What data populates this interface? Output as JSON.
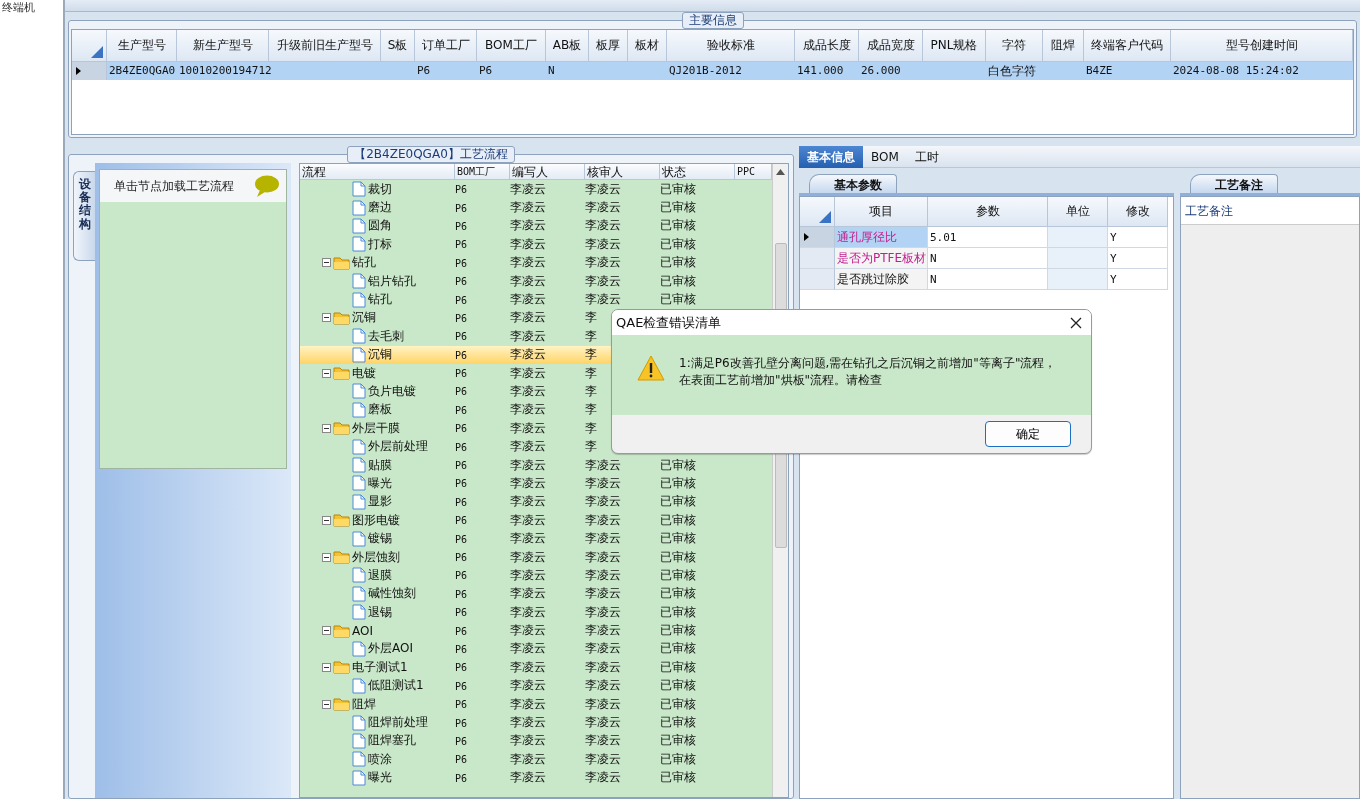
{
  "side_strip": {
    "text": "终端机"
  },
  "main_info": {
    "title": "主要信息",
    "columns": [
      "生产型号",
      "新生产型号",
      "升级前旧生产型号",
      "S板",
      "订单工厂",
      "BOM工厂",
      "AB板",
      "板厚",
      "板材",
      "验收标准",
      "成品长度",
      "成品宽度",
      "PNL规格",
      "字符",
      "阻焊",
      "终端客户代码",
      "型号创建时间"
    ],
    "rows": [
      {
        "selected": true,
        "cells": [
          "2B4ZE0QGA0",
          "10010200194712",
          "",
          "",
          "P6",
          "P6",
          "N",
          "",
          "",
          "QJ201B-2012",
          "141.000",
          "26.000",
          "",
          "白色字符",
          "",
          "B4ZE",
          "2024-08-08 15:24:02"
        ]
      }
    ]
  },
  "process": {
    "title": "【2B4ZE0QGA0】工艺流程",
    "side_tab": "设备结构",
    "hint": "单击节点加载工艺流程",
    "columns": [
      "流程",
      "BOM工厂",
      "编写人",
      "核审人",
      "状态",
      "PPC"
    ],
    "nodes": [
      {
        "children": [
          {
            "label": "裁切",
            "bom": "P6",
            "author": "李凌云",
            "reviewer": "李凌云",
            "status": "已审核",
            "selected": false
          },
          {
            "label": "磨边",
            "bom": "P6",
            "author": "李凌云",
            "reviewer": "李凌云",
            "status": "已审核",
            "selected": false
          },
          {
            "label": "圆角",
            "bom": "P6",
            "author": "李凌云",
            "reviewer": "李凌云",
            "status": "已审核",
            "selected": false
          },
          {
            "label": "打标",
            "bom": "P6",
            "author": "李凌云",
            "reviewer": "李凌云",
            "status": "已审核",
            "selected": false
          }
        ]
      },
      {
        "label": "钻孔",
        "bom": "P6",
        "author": "李凌云",
        "reviewer": "李凌云",
        "status": "已审核",
        "selected": false,
        "expanded": true,
        "children": [
          {
            "label": "铝片钻孔",
            "bom": "P6",
            "author": "李凌云",
            "reviewer": "李凌云",
            "status": "已审核",
            "selected": false
          },
          {
            "label": "钻孔",
            "bom": "P6",
            "author": "李凌云",
            "reviewer": "李凌云",
            "status": "已审核",
            "selected": false
          }
        ]
      },
      {
        "label": "沉铜",
        "bom": "P6",
        "author": "李凌云",
        "reviewer": "李",
        "selected": false,
        "expanded": true,
        "children": [
          {
            "label": "去毛刺",
            "bom": "P6",
            "author": "李凌云",
            "reviewer": "李",
            "selected": false
          },
          {
            "label": "沉铜",
            "bom": "P6",
            "author": "李凌云",
            "reviewer": "李",
            "selected": true
          }
        ]
      },
      {
        "label": "电镀",
        "bom": "P6",
        "author": "李凌云",
        "reviewer": "李",
        "selected": false,
        "expanded": true,
        "children": [
          {
            "label": "负片电镀",
            "bom": "P6",
            "author": "李凌云",
            "reviewer": "李",
            "selected": false
          },
          {
            "label": "磨板",
            "bom": "P6",
            "author": "李凌云",
            "reviewer": "李",
            "selected": false
          }
        ]
      },
      {
        "label": "外层干膜",
        "bom": "P6",
        "author": "李凌云",
        "reviewer": "李",
        "selected": false,
        "expanded": true,
        "children": [
          {
            "label": "外层前处理",
            "bom": "P6",
            "author": "李凌云",
            "reviewer": "李",
            "selected": false
          },
          {
            "label": "贴膜",
            "bom": "P6",
            "author": "李凌云",
            "reviewer": "李凌云",
            "status": "已审核",
            "selected": false
          },
          {
            "label": "曝光",
            "bom": "P6",
            "author": "李凌云",
            "reviewer": "李凌云",
            "status": "已审核",
            "selected": false
          },
          {
            "label": "显影",
            "bom": "P6",
            "author": "李凌云",
            "reviewer": "李凌云",
            "status": "已审核",
            "selected": false
          }
        ]
      },
      {
        "label": "图形电镀",
        "bom": "P6",
        "author": "李凌云",
        "reviewer": "李凌云",
        "status": "已审核",
        "selected": false,
        "expanded": true,
        "children": [
          {
            "label": "镀锡",
            "bom": "P6",
            "author": "李凌云",
            "reviewer": "李凌云",
            "status": "已审核",
            "selected": false
          }
        ]
      },
      {
        "label": "外层蚀刻",
        "bom": "P6",
        "author": "李凌云",
        "reviewer": "李凌云",
        "status": "已审核",
        "selected": false,
        "expanded": true,
        "children": [
          {
            "label": "退膜",
            "bom": "P6",
            "author": "李凌云",
            "reviewer": "李凌云",
            "status": "已审核",
            "selected": false
          },
          {
            "label": "碱性蚀刻",
            "bom": "P6",
            "author": "李凌云",
            "reviewer": "李凌云",
            "status": "已审核",
            "selected": false
          },
          {
            "label": "退锡",
            "bom": "P6",
            "author": "李凌云",
            "reviewer": "李凌云",
            "status": "已审核",
            "selected": false
          }
        ]
      },
      {
        "label": "AOI",
        "bom": "P6",
        "author": "李凌云",
        "reviewer": "李凌云",
        "status": "已审核",
        "selected": false,
        "expanded": true,
        "children": [
          {
            "label": "外层AOI",
            "bom": "P6",
            "author": "李凌云",
            "reviewer": "李凌云",
            "status": "已审核",
            "selected": false
          }
        ]
      },
      {
        "label": "电子测试1",
        "bom": "P6",
        "author": "李凌云",
        "reviewer": "李凌云",
        "status": "已审核",
        "selected": false,
        "expanded": true,
        "children": [
          {
            "label": "低阻测试1",
            "bom": "P6",
            "author": "李凌云",
            "reviewer": "李凌云",
            "status": "已审核",
            "selected": false
          }
        ]
      },
      {
        "label": "阻焊",
        "bom": "P6",
        "author": "李凌云",
        "reviewer": "李凌云",
        "status": "已审核",
        "selected": false,
        "expanded": true,
        "children": [
          {
            "label": "阻焊前处理",
            "bom": "P6",
            "author": "李凌云",
            "reviewer": "李凌云",
            "status": "已审核",
            "selected": false
          },
          {
            "label": "阻焊塞孔",
            "bom": "P6",
            "author": "李凌云",
            "reviewer": "李凌云",
            "status": "已审核",
            "selected": false
          },
          {
            "label": "喷涂",
            "bom": "P6",
            "author": "李凌云",
            "reviewer": "李凌云",
            "status": "已审核",
            "selected": false
          },
          {
            "label": "曝光",
            "bom": "P6",
            "author": "李凌云",
            "reviewer": "李凌云",
            "status": "已审核",
            "selected": false
          }
        ]
      }
    ]
  },
  "detail_tabs": [
    {
      "label": "基本信息",
      "selected": true
    },
    {
      "label": "BOM",
      "selected": false
    },
    {
      "label": "工时",
      "selected": false
    }
  ],
  "params": {
    "tab": "基本参数",
    "columns": [
      "项目",
      "参数",
      "单位",
      "修改"
    ],
    "rows": [
      {
        "item": "通孔厚径比",
        "value": "5.01",
        "unit": "",
        "modified": "Y",
        "highlighted": true,
        "selected": true
      },
      {
        "item": "是否为PTFE板材",
        "value": "N",
        "unit": "",
        "modified": "Y",
        "highlighted": true,
        "selected": false
      },
      {
        "item": "是否跳过除胶",
        "value": "N",
        "unit": "",
        "modified": "Y",
        "highlighted": false,
        "selected": false
      }
    ]
  },
  "remarks": {
    "tab": "工艺备注",
    "label": "工艺备注"
  },
  "dialog": {
    "title": "QAE检查错误清单",
    "message": "1:满足P6改善孔壁分离问题,需在钻孔之后沉铜之前增加\"等离子\"流程，在表面工艺前增加\"烘板\"流程。请检查",
    "button": "确定"
  }
}
